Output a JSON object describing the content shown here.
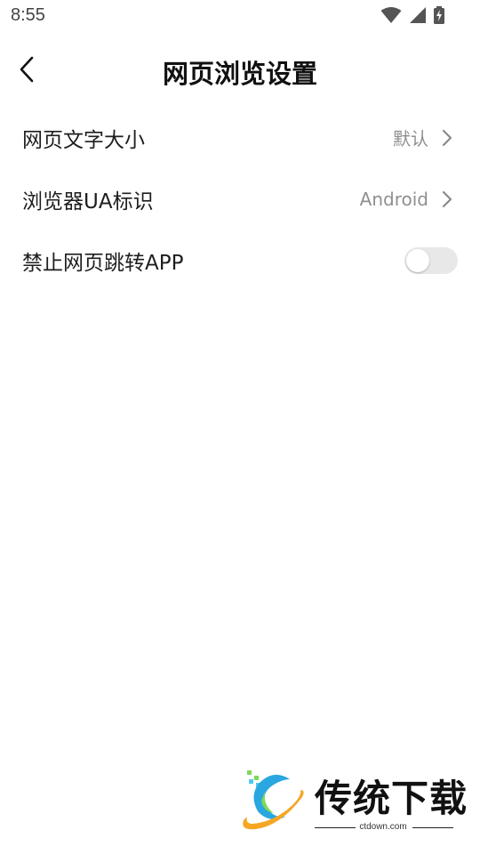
{
  "status_bar": {
    "time": "8:55",
    "icons": [
      "wifi-icon",
      "signal-icon",
      "battery-charging-icon"
    ]
  },
  "header": {
    "title": "网页浏览设置",
    "back_icon": "back-arrow-icon"
  },
  "settings": {
    "font_size": {
      "label": "网页文字大小",
      "value": "默认"
    },
    "user_agent": {
      "label": "浏览器UA标识",
      "value": "Android"
    },
    "block_app_jump": {
      "label": "禁止网页跳转APP",
      "enabled": false
    }
  },
  "watermark": {
    "brand": "传统下载",
    "url": "ctdown.com"
  },
  "colors": {
    "background": "#ffffff",
    "text_primary": "#1e1e1e",
    "text_secondary": "#8f8f8f",
    "toggle_off": "#e8e8e8"
  }
}
